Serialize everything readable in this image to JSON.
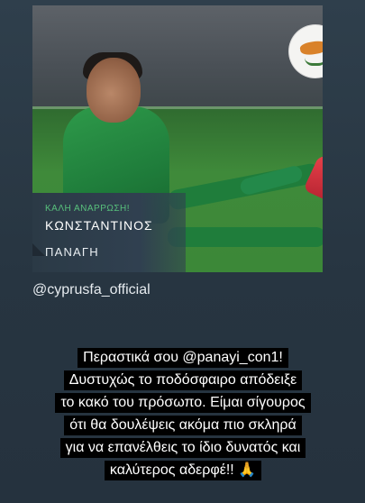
{
  "post": {
    "caption_top": "ΚΑΛΗ ΑΝΑΡΡΩΣΗ!",
    "caption_name": "ΚΩΝΣΤΑΝΤΙΝΟΣ",
    "caption_surname": "ΠΑΝΑΓΗ",
    "mention": "@cyprusfa_official"
  },
  "story_text": {
    "lines": [
      "Περαστικά σου @panayi_con1!",
      "Δυστυχώς το ποδόσφαιρο απόδειξε",
      "το κακό του πρόσωπο. Είμαι σίγουρος",
      "ότι θα δουλέψεις ακόμα πιο σκληρά",
      "για να επανέλθεις το ίδιο δυνατός και",
      "καλύτερος αδερφέ!! 🙏"
    ]
  },
  "colors": {
    "background": "#2b3a46",
    "caption_accent": "#58c07c",
    "text_chip": "#000000",
    "boot": "#e8424a"
  },
  "icons": {
    "badge": "cyprus-fa-badge-icon"
  }
}
